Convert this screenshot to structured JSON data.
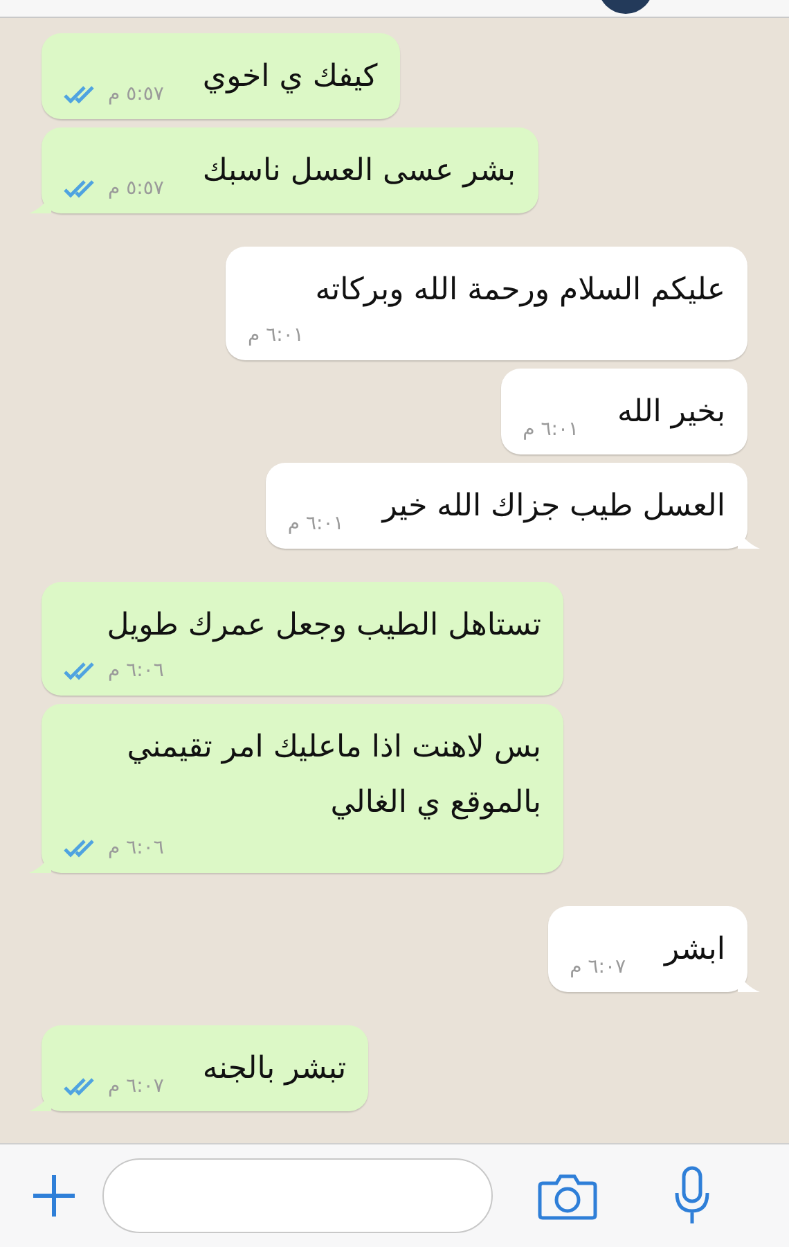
{
  "messages": [
    {
      "kind": "sent",
      "text": "كيفك ي اخوي",
      "time": "٥:٥٧ م",
      "read": true,
      "tail": false
    },
    {
      "kind": "sent",
      "text": "بشر عسى العسل ناسبك",
      "time": "٥:٥٧ م",
      "read": true,
      "tail": true
    },
    {
      "kind": "received",
      "text": "عليكم السلام ورحمة الله وبركاته",
      "time": "٦:٠١ م",
      "tail": false
    },
    {
      "kind": "received",
      "text": "بخير الله",
      "time": "٦:٠١ م",
      "tail": false
    },
    {
      "kind": "received",
      "text": "العسل طيب جزاك الله خير",
      "time": "٦:٠١ م",
      "tail": true
    },
    {
      "kind": "sent",
      "text": "تستاهل الطيب وجعل عمرك طويل",
      "time": "٦:٠٦ م",
      "read": true,
      "tail": false
    },
    {
      "kind": "sent",
      "text": "بس لاهنت اذا ماعليك امر تقيمني بالموقع ي الغالي",
      "time": "٦:٠٦ م",
      "read": true,
      "tail": true
    },
    {
      "kind": "received",
      "text": "ابشر",
      "time": "٦:٠٧ م",
      "tail": true
    },
    {
      "kind": "sent",
      "text": "تبشر بالجنه",
      "time": "٦:٠٧ م",
      "read": true,
      "tail": true
    }
  ]
}
